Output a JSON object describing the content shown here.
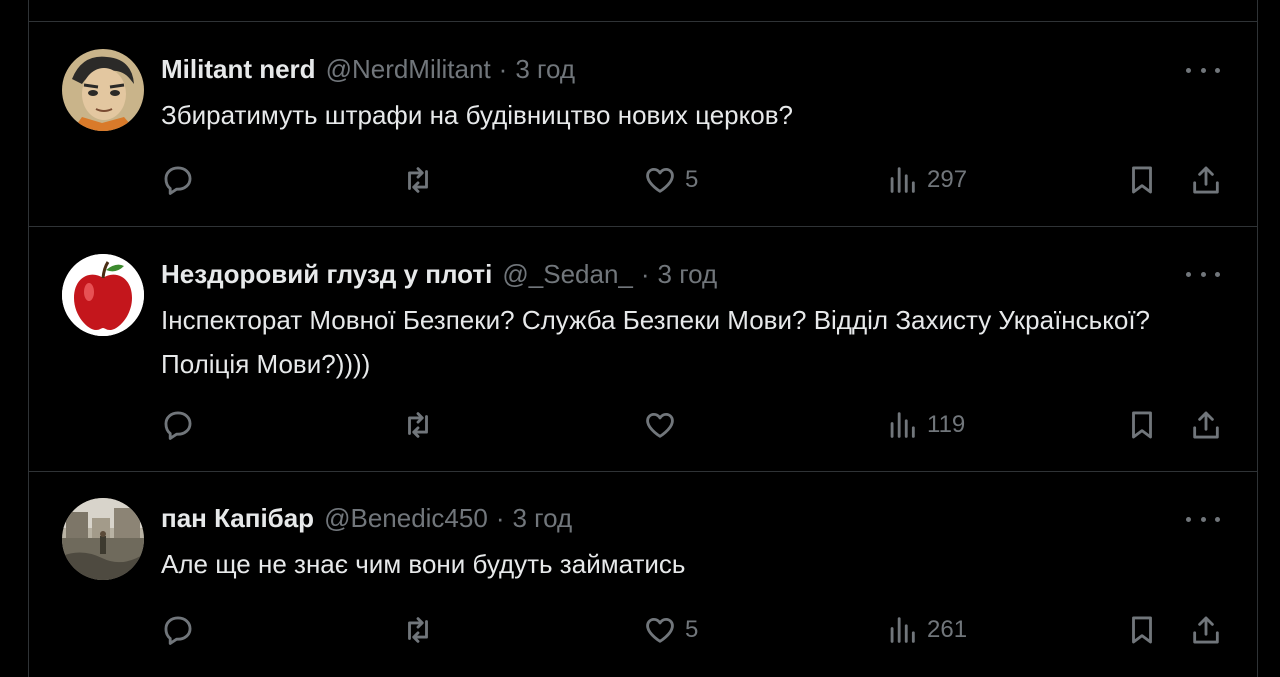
{
  "tweets": [
    {
      "name": "Militant nerd",
      "handle": "@NerdMilitant",
      "dot": "·",
      "time": "3 год",
      "text": "Збиратимуть штрафи на будівництво нових церков?",
      "likes": "5",
      "views": "297",
      "avatar_icon": "cartoon-avatar"
    },
    {
      "name": "Нездоровий глузд у плоті",
      "handle": "@_Sedan_",
      "dot": "·",
      "time": "3 год",
      "text": "Інспекторат Мовної Безпеки? Служба Безпеки Мови? Відділ Захисту Української? Поліція Мови?))))",
      "likes": "",
      "views": "119",
      "avatar_icon": "apple-avatar"
    },
    {
      "name": "пан Капібар",
      "handle": "@Benedic450",
      "dot": "·",
      "time": "3 год",
      "text": "Але ще не знає чим вони будуть займатись",
      "likes": "5",
      "views": "261",
      "avatar_icon": "photo-avatar"
    }
  ],
  "colors": {
    "background": "#000000",
    "border": "#2f3336",
    "text": "#e7e9ea",
    "muted": "#71767b"
  }
}
